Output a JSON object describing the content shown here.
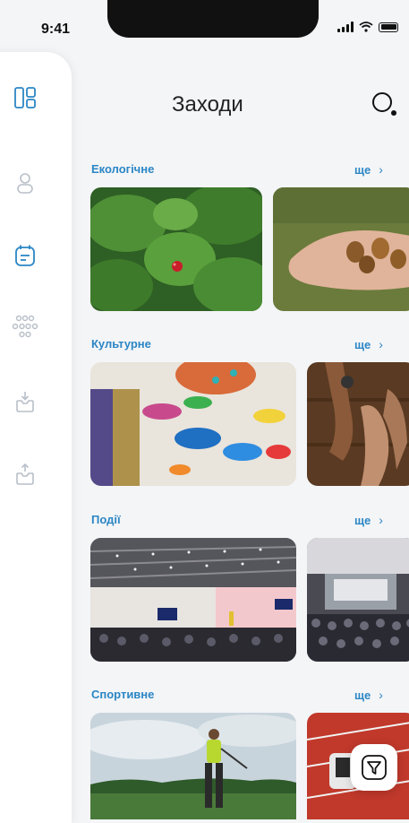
{
  "status": {
    "time": "9:41"
  },
  "header": {
    "title": "Заходи"
  },
  "sidebar": {
    "items": [
      {
        "icon": "dashboard-icon"
      },
      {
        "icon": "profile-icon"
      },
      {
        "icon": "calendar-icon"
      },
      {
        "icon": "groups-icon"
      },
      {
        "icon": "inbox-download-icon"
      },
      {
        "icon": "inbox-upload-icon"
      }
    ]
  },
  "sections": [
    {
      "title": "Екологічне",
      "more": "ще"
    },
    {
      "title": "Культурне",
      "more": "ще"
    },
    {
      "title": "Події",
      "more": "ще"
    },
    {
      "title": "Спортивне",
      "more": "ще"
    }
  ],
  "colors": {
    "accent": "#2b86c5",
    "background": "#f4f5f7"
  }
}
